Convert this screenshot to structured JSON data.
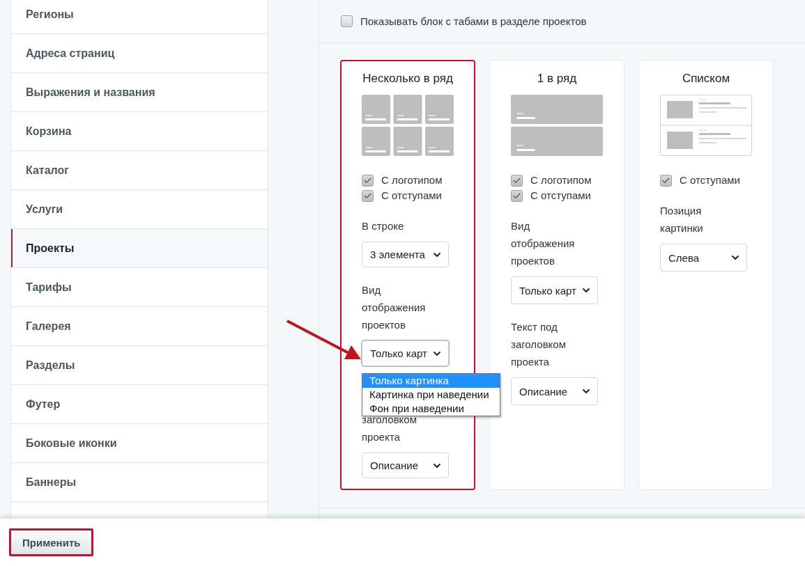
{
  "sidebar": {
    "items": [
      {
        "label": "Регионы",
        "selected": false
      },
      {
        "label": "Адреса страниц",
        "selected": false
      },
      {
        "label": "Выражения и названия",
        "selected": false
      },
      {
        "label": "Корзина",
        "selected": false
      },
      {
        "label": "Каталог",
        "selected": false
      },
      {
        "label": "Услуги",
        "selected": false
      },
      {
        "label": "Проекты",
        "selected": true
      },
      {
        "label": "Тарифы",
        "selected": false
      },
      {
        "label": "Галерея",
        "selected": false
      },
      {
        "label": "Разделы",
        "selected": false
      },
      {
        "label": "Футер",
        "selected": false
      },
      {
        "label": "Боковые иконки",
        "selected": false
      },
      {
        "label": "Баннеры",
        "selected": false
      }
    ]
  },
  "tabs_option": {
    "label": "Показывать блок с табами в разделе проектов",
    "checked": false
  },
  "cards": [
    {
      "title": "Несколько в ряд",
      "selected": true,
      "kind": "grid",
      "options": [
        {
          "label": "С логотипом",
          "checked": true
        },
        {
          "label": "С отступами",
          "checked": true
        }
      ],
      "fields": [
        {
          "label": "В строке",
          "value": "3 элемента"
        },
        {
          "label": "Вид отображения проектов",
          "value": "Только карт",
          "open": true,
          "options": [
            {
              "label": "Только картинка",
              "selected": true
            },
            {
              "label": "Картинка при наведении",
              "selected": false
            },
            {
              "label": "Фон при наведении",
              "selected": false
            }
          ]
        },
        {
          "label": "заголовком проекта",
          "value": "Описание"
        }
      ]
    },
    {
      "title": "1 в ряд",
      "selected": false,
      "kind": "rows",
      "options": [
        {
          "label": "С логотипом",
          "checked": true
        },
        {
          "label": "С отступами",
          "checked": true
        }
      ],
      "fields": [
        {
          "label": "Вид отображения проектов",
          "value": "Только карт"
        },
        {
          "label": "Текст под заголовком проекта",
          "value": "Описание"
        }
      ]
    },
    {
      "title": "Списком",
      "selected": false,
      "kind": "list",
      "options": [
        {
          "label": "С отступами",
          "checked": true
        }
      ],
      "fields": [
        {
          "label": "Позиция картинки",
          "value": "Слева"
        }
      ]
    }
  ],
  "apply_button": {
    "label": "Применить",
    "highlighted": true
  }
}
